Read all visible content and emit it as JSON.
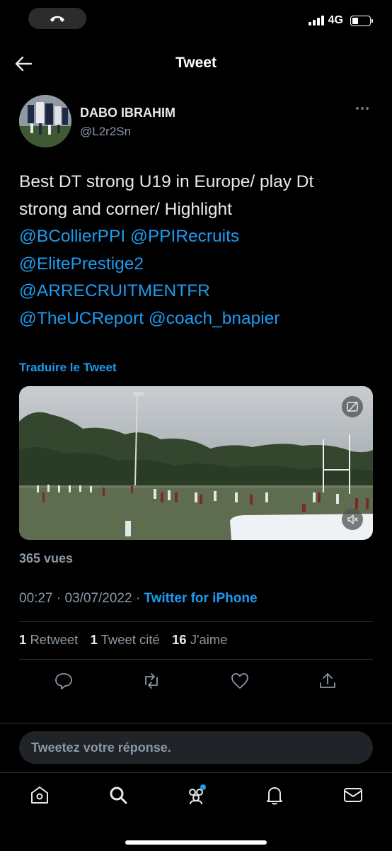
{
  "status": {
    "network": "4G",
    "battery_level": 0.35
  },
  "header": {
    "title": "Tweet"
  },
  "author": {
    "name": "DABO IBRAHIM",
    "handle": "@L2r2Sn"
  },
  "tweet": {
    "text_parts": [
      "Best DT strong U19 in Europe/ play Dt",
      "strong and corner/ Highlight"
    ],
    "mentions": [
      "@BCollierPPI",
      "@PPIRecruits",
      "@ElitePrestige2",
      "@ARRECRUITMENTFR",
      "@TheUCReport",
      "@coach_bnapier"
    ],
    "translate_label": "Traduire le Tweet",
    "views": "365 vues",
    "time": "00:27",
    "date": "03/07/2022",
    "source": "Twitter for iPhone",
    "stats": {
      "retweets_count": "1",
      "retweets_label": "Retweet",
      "quotes_count": "1",
      "quotes_label": "Tweet cité",
      "likes_count": "16",
      "likes_label": "J'aime"
    }
  },
  "reply": {
    "placeholder": "Tweetez votre réponse."
  },
  "icons": {
    "back": "arrow-left-icon",
    "more": "more-horizontal-icon",
    "reply": "comment-icon",
    "retweet": "retweet-icon",
    "like": "heart-icon",
    "share": "share-icon",
    "captions": "captions-icon",
    "mute": "volume-mute-icon",
    "tabs": [
      "home-icon",
      "search-icon",
      "communities-icon",
      "notifications-icon",
      "messages-icon"
    ]
  },
  "colors": {
    "background": "#000000",
    "accent": "#1d9bf0",
    "text": "#e7e9ea",
    "secondary": "#8b98a5",
    "divider": "#2f3336"
  }
}
